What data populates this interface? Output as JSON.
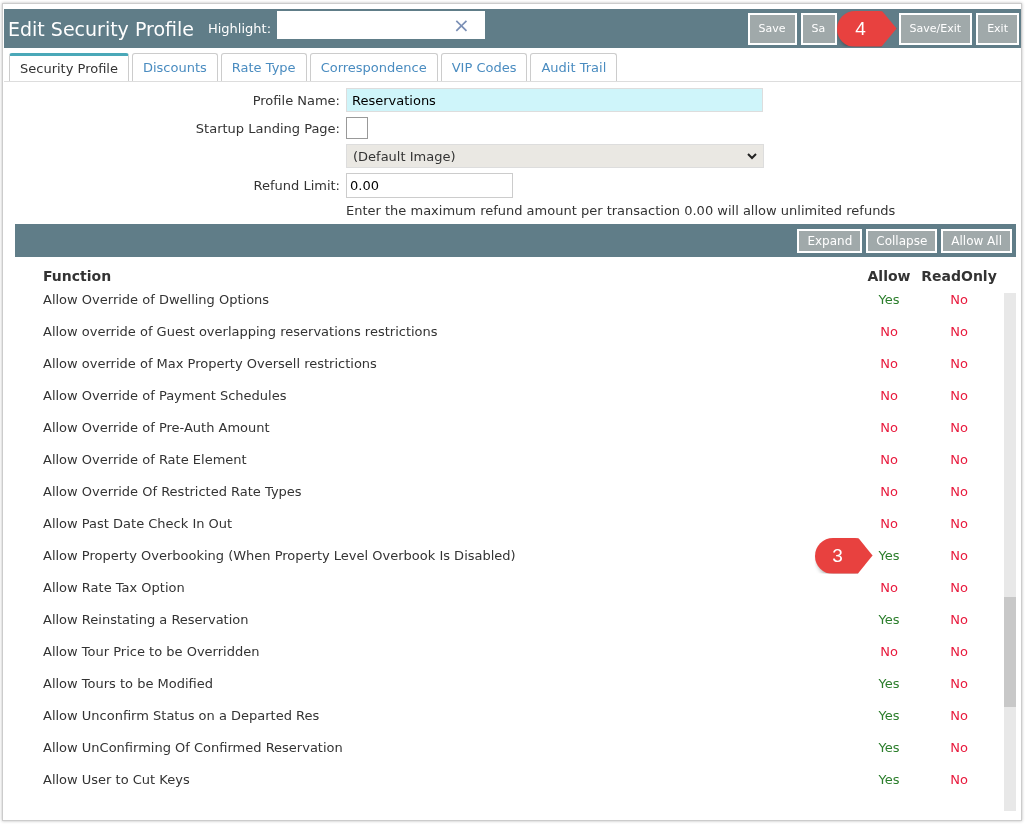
{
  "window": {
    "title": "Edit Security Profile"
  },
  "highlight": {
    "label": "Highlight:",
    "clear": "×"
  },
  "buttons": [
    {
      "label": "Save"
    },
    {
      "label": "Sa"
    },
    {
      "label": "Save/Exit",
      "callout": "4"
    },
    {
      "label": "Exit"
    }
  ],
  "tabs": [
    {
      "label": "Security Profile",
      "selected": true
    },
    {
      "label": "Discounts",
      "selected": false
    },
    {
      "label": "Rate Type",
      "selected": false
    },
    {
      "label": "Correspondence",
      "selected": false
    },
    {
      "label": "VIP Codes",
      "selected": false
    },
    {
      "label": "Audit Trail",
      "selected": false
    }
  ],
  "form": {
    "profile_name": {
      "label": "Profile Name:",
      "value": "Reservations"
    },
    "startup_landing_page": {
      "label": "Startup Landing Page:",
      "checked": false,
      "select": "(Default Image)"
    },
    "refund_limit": {
      "label": "Refund Limit:",
      "value": "0.00",
      "hint": "Enter the maximum refund amount per transaction 0.00 will allow unlimited refunds"
    }
  },
  "toolbar": [
    "Expand",
    "Collapse",
    "Allow All"
  ],
  "table": {
    "columns": [
      "Function",
      "Allow",
      "ReadOnly"
    ],
    "rows": [
      {
        "function": "Allow Override of Dwelling Options",
        "allow": {
          "text": "Yes",
          "granted": true
        },
        "readonly": {
          "text": "No",
          "granted": false
        }
      },
      {
        "function": "Allow override of Guest overlapping reservations restrictions",
        "allow": {
          "text": "No",
          "granted": false
        },
        "readonly": {
          "text": "No",
          "granted": false
        }
      },
      {
        "function": "Allow override of Max Property Oversell restrictions",
        "allow": {
          "text": "No",
          "granted": false
        },
        "readonly": {
          "text": "No",
          "granted": false
        }
      },
      {
        "function": "Allow Override of Payment Schedules",
        "allow": {
          "text": "No",
          "granted": false
        },
        "readonly": {
          "text": "No",
          "granted": false
        }
      },
      {
        "function": "Allow Override of Pre-Auth Amount",
        "allow": {
          "text": "No",
          "granted": false
        },
        "readonly": {
          "text": "No",
          "granted": false
        }
      },
      {
        "function": "Allow Override of Rate Element",
        "allow": {
          "text": "No",
          "granted": false
        },
        "readonly": {
          "text": "No",
          "granted": false
        }
      },
      {
        "function": "Allow Override Of Restricted Rate Types",
        "allow": {
          "text": "No",
          "granted": false
        },
        "readonly": {
          "text": "No",
          "granted": false
        }
      },
      {
        "function": "Allow Past Date Check In Out",
        "allow": {
          "text": "No",
          "granted": false
        },
        "readonly": {
          "text": "No",
          "granted": false
        }
      },
      {
        "function": "Allow Property Overbooking (When Property Level Overbook Is Disabled)",
        "allow": {
          "text": "Yes",
          "granted": true,
          "callout": "3"
        },
        "readonly": {
          "text": "No",
          "granted": false
        }
      },
      {
        "function": "Allow Rate Tax Option",
        "allow": {
          "text": "No",
          "granted": false
        },
        "readonly": {
          "text": "No",
          "granted": false
        }
      },
      {
        "function": "Allow Reinstating a Reservation",
        "allow": {
          "text": "Yes",
          "granted": true
        },
        "readonly": {
          "text": "No",
          "granted": false
        }
      },
      {
        "function": "Allow Tour Price to be Overridden",
        "allow": {
          "text": "No",
          "granted": false
        },
        "readonly": {
          "text": "No",
          "granted": false
        }
      },
      {
        "function": "Allow Tours to be Modified",
        "allow": {
          "text": "Yes",
          "granted": true
        },
        "readonly": {
          "text": "No",
          "granted": false
        }
      },
      {
        "function": "Allow Unconfirm Status on a Departed Res",
        "allow": {
          "text": "Yes",
          "granted": true
        },
        "readonly": {
          "text": "No",
          "granted": false
        }
      },
      {
        "function": "Allow UnConfirming Of Confirmed Reservation",
        "allow": {
          "text": "Yes",
          "granted": true
        },
        "readonly": {
          "text": "No",
          "granted": false
        }
      },
      {
        "function": "Allow User to Cut Keys",
        "allow": {
          "text": "Yes",
          "granted": true
        },
        "readonly": {
          "text": "No",
          "granted": false
        }
      }
    ]
  }
}
